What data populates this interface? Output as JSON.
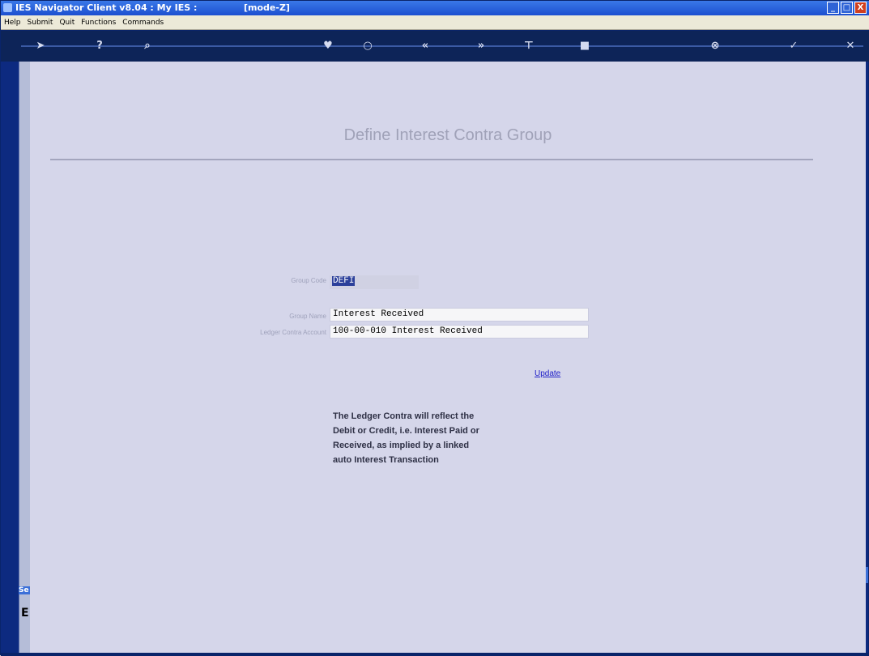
{
  "window": {
    "title": "IES Navigator Client v8.04 : My IES :",
    "mode": "[mode-Z]",
    "controls": [
      "_",
      "□",
      "X"
    ]
  },
  "menu": [
    "Help",
    "Submit",
    "Quit",
    "Functions",
    "Commands"
  ],
  "toolbar": {
    "icons": [
      "arrow-right-icon",
      "help-icon",
      "search-icon",
      "heart-icon",
      "circle-icon",
      "rewind-icon",
      "forward-icon",
      "bookmark-icon",
      "square-icon",
      "delete-icon",
      "check-icon",
      "close-icon"
    ]
  },
  "page": {
    "title": "Define Interest Contra Group"
  },
  "form": {
    "group_code_label": "Group Code",
    "group_code_value": "DEFI",
    "group_name_label": "Group Name",
    "group_name_value": "Interest Received",
    "ledger_contra_label": "Ledger Contra Account",
    "ledger_contra_value": "100-00-010 Interest Received",
    "update_label": "Update"
  },
  "note": {
    "lines": [
      "The Ledger Contra will reflect the",
      "Debit or Credit, i.e. Interest Paid or",
      "Received, as implied by a linked",
      "auto Interest Transaction"
    ]
  },
  "sidebar": {
    "tab_label": "Se",
    "mark": "E"
  },
  "colors": {
    "content_bg": "#d5d6ea",
    "title_color": "#a0a2b8",
    "link_color": "#2020c8",
    "toolbar_bg": "#0d2458"
  }
}
